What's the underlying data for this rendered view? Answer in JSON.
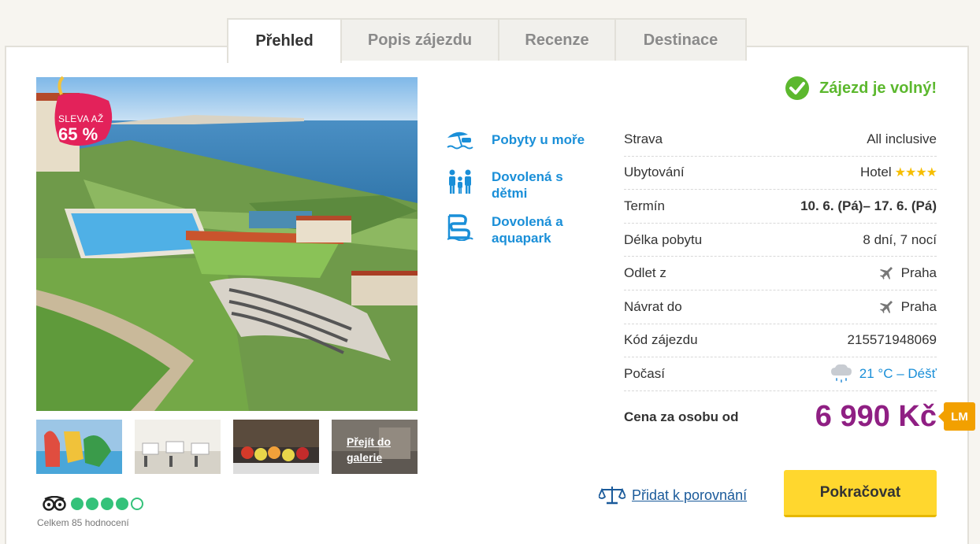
{
  "tabs": [
    {
      "label": "Přehled",
      "active": true
    },
    {
      "label": "Popis zájezdu",
      "active": false
    },
    {
      "label": "Recenze",
      "active": false
    },
    {
      "label": "Destinace",
      "active": false
    }
  ],
  "discount": {
    "line1": "SLEVA AŽ",
    "line2": "65 %"
  },
  "gallery_link": "Přejít do galerie",
  "rating": {
    "provider_icon": "tripadvisor-owl-icon",
    "filled": 4,
    "total": 5,
    "count_text": "Celkem 85 hodnocení"
  },
  "categories": [
    {
      "icon": "beach-umbrella-icon",
      "label": "Pobyty u moře"
    },
    {
      "icon": "family-icon",
      "label": "Dovolená s dětmi"
    },
    {
      "icon": "waterslide-icon",
      "label": "Dovolená a aquapark"
    }
  ],
  "status": {
    "icon": "check-circle-icon",
    "text": "Zájezd je volný!",
    "color": "#5cb82e"
  },
  "info": {
    "strava": {
      "label": "Strava",
      "value": "All inclusive"
    },
    "ubytovani": {
      "label": "Ubytování",
      "value": "Hotel",
      "stars": "★★★★"
    },
    "termin": {
      "label": "Termín",
      "value": "10. 6. (Pá)– 17. 6. (Pá)"
    },
    "delka": {
      "label": "Délka pobytu",
      "value": "8 dní, 7 nocí"
    },
    "odlet": {
      "label": "Odlet z",
      "value": "Praha"
    },
    "navrat": {
      "label": "Návrat do",
      "value": "Praha"
    },
    "kod": {
      "label": "Kód zájezdu",
      "value": "215571948069"
    },
    "pocasi": {
      "label": "Počasí",
      "value": "21 °C – Déšť"
    }
  },
  "price": {
    "label": "Cena za osobu od",
    "value": "6 990 Kč",
    "badge": "LM",
    "color": "#8f1f83"
  },
  "compare_label": "Přidat k porovnání",
  "continue_label": "Pokračovat"
}
